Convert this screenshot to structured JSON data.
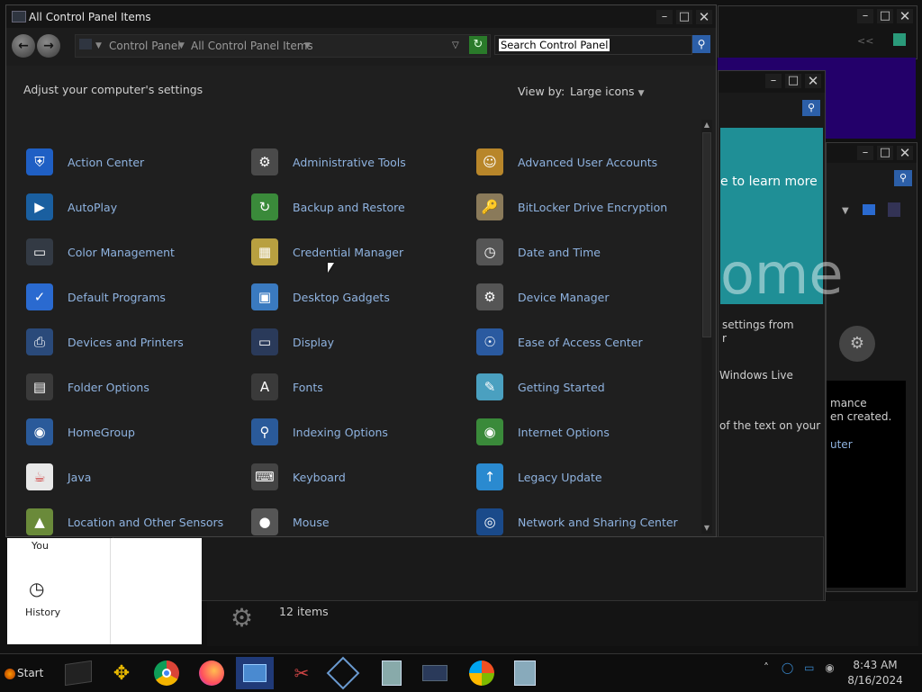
{
  "window": {
    "title": "All Control Panel Items",
    "breadcrumb": [
      "Control Panel",
      "All Control Panel Items"
    ],
    "search_placeholder": "Search Control Panel",
    "header": "Adjust your computer's settings",
    "view_by_label": "View by:",
    "view_by_value": "Large icons"
  },
  "items": [
    {
      "label": "Action Center",
      "icon": "shield-icon",
      "color": "#1f5fc4"
    },
    {
      "label": "Administrative Tools",
      "icon": "tools-icon",
      "color": "#4a4a4a"
    },
    {
      "label": "Advanced User Accounts",
      "icon": "users-icon",
      "color": "#b8862a"
    },
    {
      "label": "AutoPlay",
      "icon": "autoplay-icon",
      "color": "#1a5fa0"
    },
    {
      "label": "Backup and Restore",
      "icon": "backup-icon",
      "color": "#3a8a3a"
    },
    {
      "label": "BitLocker Drive Encryption",
      "icon": "lock-icon",
      "color": "#8a7a5a"
    },
    {
      "label": "Color Management",
      "icon": "monitor-icon",
      "color": "#333a44"
    },
    {
      "label": "Credential Manager",
      "icon": "vault-icon",
      "color": "#b8a040"
    },
    {
      "label": "Date and Time",
      "icon": "clock-icon",
      "color": "#555"
    },
    {
      "label": "Default Programs",
      "icon": "default-programs-icon",
      "color": "#2a6ad0"
    },
    {
      "label": "Desktop Gadgets",
      "icon": "gadgets-icon",
      "color": "#3a7ac0"
    },
    {
      "label": "Device Manager",
      "icon": "device-manager-icon",
      "color": "#555"
    },
    {
      "label": "Devices and Printers",
      "icon": "printer-icon",
      "color": "#2a4a7a"
    },
    {
      "label": "Display",
      "icon": "display-icon",
      "color": "#2a3a5a"
    },
    {
      "label": "Ease of Access Center",
      "icon": "accessibility-icon",
      "color": "#2a5aa0"
    },
    {
      "label": "Folder Options",
      "icon": "folder-options-icon",
      "color": "#3a3a3a"
    },
    {
      "label": "Fonts",
      "icon": "fonts-icon",
      "color": "#3a3a3a"
    },
    {
      "label": "Getting Started",
      "icon": "getting-started-icon",
      "color": "#4aa0c0"
    },
    {
      "label": "HomeGroup",
      "icon": "homegroup-icon",
      "color": "#2a5a9a"
    },
    {
      "label": "Indexing Options",
      "icon": "indexing-icon",
      "color": "#2a5a9a"
    },
    {
      "label": "Internet Options",
      "icon": "internet-icon",
      "color": "#3a8a3a"
    },
    {
      "label": "Java",
      "icon": "java-icon",
      "color": "#e8e8e8"
    },
    {
      "label": "Keyboard",
      "icon": "keyboard-icon",
      "color": "#444"
    },
    {
      "label": "Legacy Update",
      "icon": "update-icon",
      "color": "#2a8ad0"
    },
    {
      "label": "Location and Other Sensors",
      "icon": "location-icon",
      "color": "#6a8a3a"
    },
    {
      "label": "Mouse",
      "icon": "mouse-icon",
      "color": "#555"
    },
    {
      "label": "Network and Sharing Center",
      "icon": "network-icon",
      "color": "#1a4a8a"
    }
  ],
  "background": {
    "learn_more": "e to learn more",
    "welcome_fragment": "ome",
    "settings_from": "settings from",
    "settings_from_2": "r",
    "windows_live": "Windows Live",
    "text_on_your": "of the text on your",
    "mance": "mance",
    "en_created": "en created.",
    "uter": "uter",
    "collapse": "<<",
    "status_items": "12 items"
  },
  "side_panel": {
    "you_label": "You",
    "history_label": "History"
  },
  "taskbar": {
    "start_label": "Start",
    "time": "8:43 AM",
    "date": "8/16/2024"
  }
}
